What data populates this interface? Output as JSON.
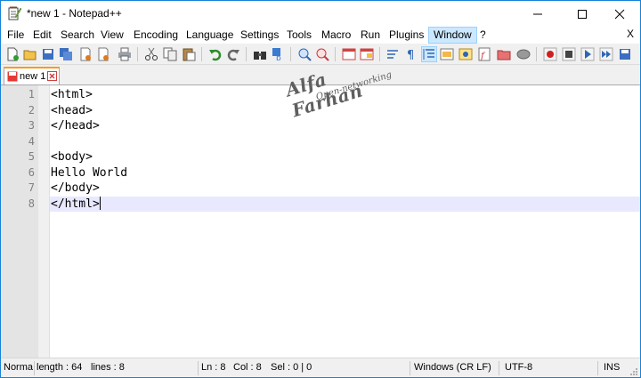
{
  "window": {
    "title": "*new 1 - Notepad++"
  },
  "menu": {
    "items": [
      {
        "label": "File",
        "key": "file"
      },
      {
        "label": "Edit",
        "key": "edit"
      },
      {
        "label": "Search",
        "key": "search"
      },
      {
        "label": "View",
        "key": "view"
      },
      {
        "label": "Encoding",
        "key": "encoding"
      },
      {
        "label": "Language",
        "key": "language"
      },
      {
        "label": "Settings",
        "key": "settings"
      },
      {
        "label": "Tools",
        "key": "tools"
      },
      {
        "label": "Macro",
        "key": "macro"
      },
      {
        "label": "Run",
        "key": "run"
      },
      {
        "label": "Plugins",
        "key": "plugins"
      },
      {
        "label": "Window",
        "key": "window",
        "active": true
      },
      {
        "label": "?",
        "key": "help"
      }
    ],
    "close_doc": "X"
  },
  "toolbar": {
    "icons": [
      "new-file-icon",
      "open-file-icon",
      "save-icon",
      "save-all-icon",
      "close-icon",
      "close-all-icon",
      "print-icon",
      "cut-icon",
      "copy-icon",
      "paste-icon",
      "undo-icon",
      "redo-icon",
      "find-icon",
      "replace-icon",
      "zoom-in-icon",
      "zoom-out-icon",
      "sync-vertical-icon",
      "sync-horizontal-icon",
      "word-wrap-icon",
      "show-all-characters-icon",
      "indent-guide-icon",
      "user-defined-language-icon",
      "document-map-icon",
      "function-list-icon",
      "folder-as-workspace-icon",
      "monitoring-icon",
      "record-macro-icon",
      "stop-recording-icon",
      "playback-macro-icon",
      "run-macro-multiple-icon",
      "save-macro-icon"
    ]
  },
  "tab": {
    "label": "new 1"
  },
  "editor": {
    "lines": [
      "<html>",
      "<head>",
      "</head>",
      "",
      "<body>",
      "Hello World",
      "</body>",
      "</html>"
    ],
    "current_line": 8
  },
  "watermark": {
    "main": "Alfa Farhan",
    "sub": "Open-networking"
  },
  "status": {
    "language": "Normal text file",
    "length": "length : 64",
    "lines": "lines : 8",
    "ln": "Ln : 8",
    "col": "Col : 8",
    "sel": "Sel : 0 | 0",
    "eol": "Windows (CR LF)",
    "encoding": "UTF-8",
    "mode": "INS"
  },
  "colors": {
    "accent": "#1883d7",
    "tab_marker": "#f99a1e",
    "current_line": "#e8e8ff",
    "menu_highlight": "#cce8ff"
  }
}
